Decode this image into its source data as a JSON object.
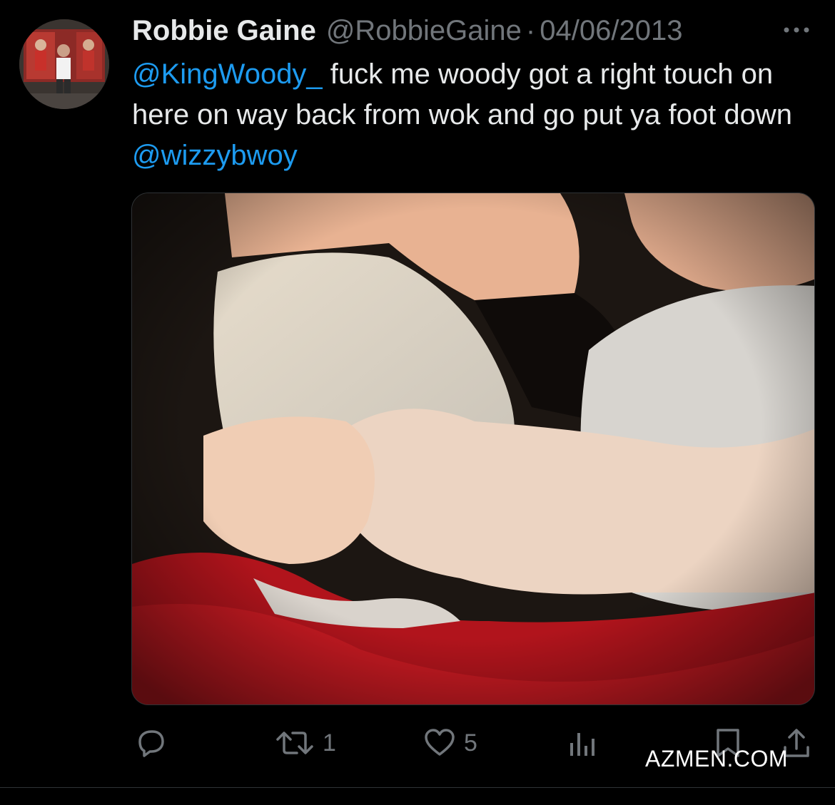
{
  "tweet": {
    "display_name": "Robbie Gaine",
    "handle": "@RobbieGaine",
    "separator": "·",
    "date": "04/06/2013",
    "text": [
      {
        "type": "mention",
        "value": "@KingWoody_"
      },
      {
        "type": "text",
        "value": " fuck me woody got a right touch on here on way back from wok and go put ya foot down "
      },
      {
        "type": "mention",
        "value": "@wizzybwoy"
      }
    ]
  },
  "actions": {
    "reply": {
      "icon": "reply-icon",
      "count": ""
    },
    "retweet": {
      "icon": "retweet-icon",
      "count": "1"
    },
    "like": {
      "icon": "heart-icon",
      "count": "5"
    },
    "views": {
      "icon": "views-chart-icon",
      "count": ""
    },
    "bookmark": {
      "icon": "bookmark-icon"
    },
    "share": {
      "icon": "share-icon"
    }
  },
  "watermark": "AZMEN.COM",
  "colors": {
    "background": "#000000",
    "text": "#e7e9ea",
    "secondary_text": "#71767b",
    "mention": "#1d9bf0"
  }
}
